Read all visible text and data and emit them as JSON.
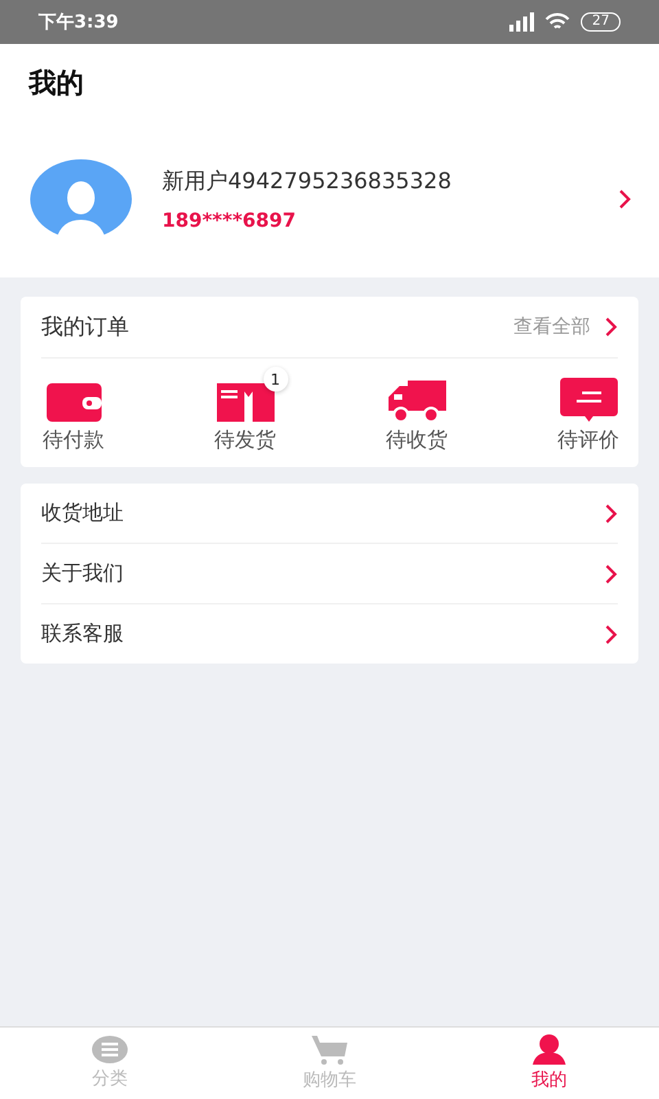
{
  "status_bar": {
    "time": "下午3:39",
    "battery": "27"
  },
  "header": {
    "title": "我的"
  },
  "profile": {
    "name": "新用户4942795236835328",
    "phone": "189****6897"
  },
  "orders": {
    "title": "我的订单",
    "view_all": "查看全部",
    "items": [
      {
        "kind": "wallet",
        "label": "待付款"
      },
      {
        "kind": "package",
        "label": "待发货",
        "badge": "1"
      },
      {
        "kind": "truck",
        "label": "待收货"
      },
      {
        "kind": "comment",
        "label": "待评价"
      }
    ]
  },
  "menu": [
    {
      "label": "收货地址"
    },
    {
      "label": "关于我们"
    },
    {
      "label": "联系客服"
    }
  ],
  "tabs": [
    {
      "kind": "category",
      "label": "分类",
      "selected": false
    },
    {
      "kind": "cart",
      "label": "购物车",
      "selected": false
    },
    {
      "kind": "user",
      "label": "我的",
      "selected": true
    }
  ]
}
